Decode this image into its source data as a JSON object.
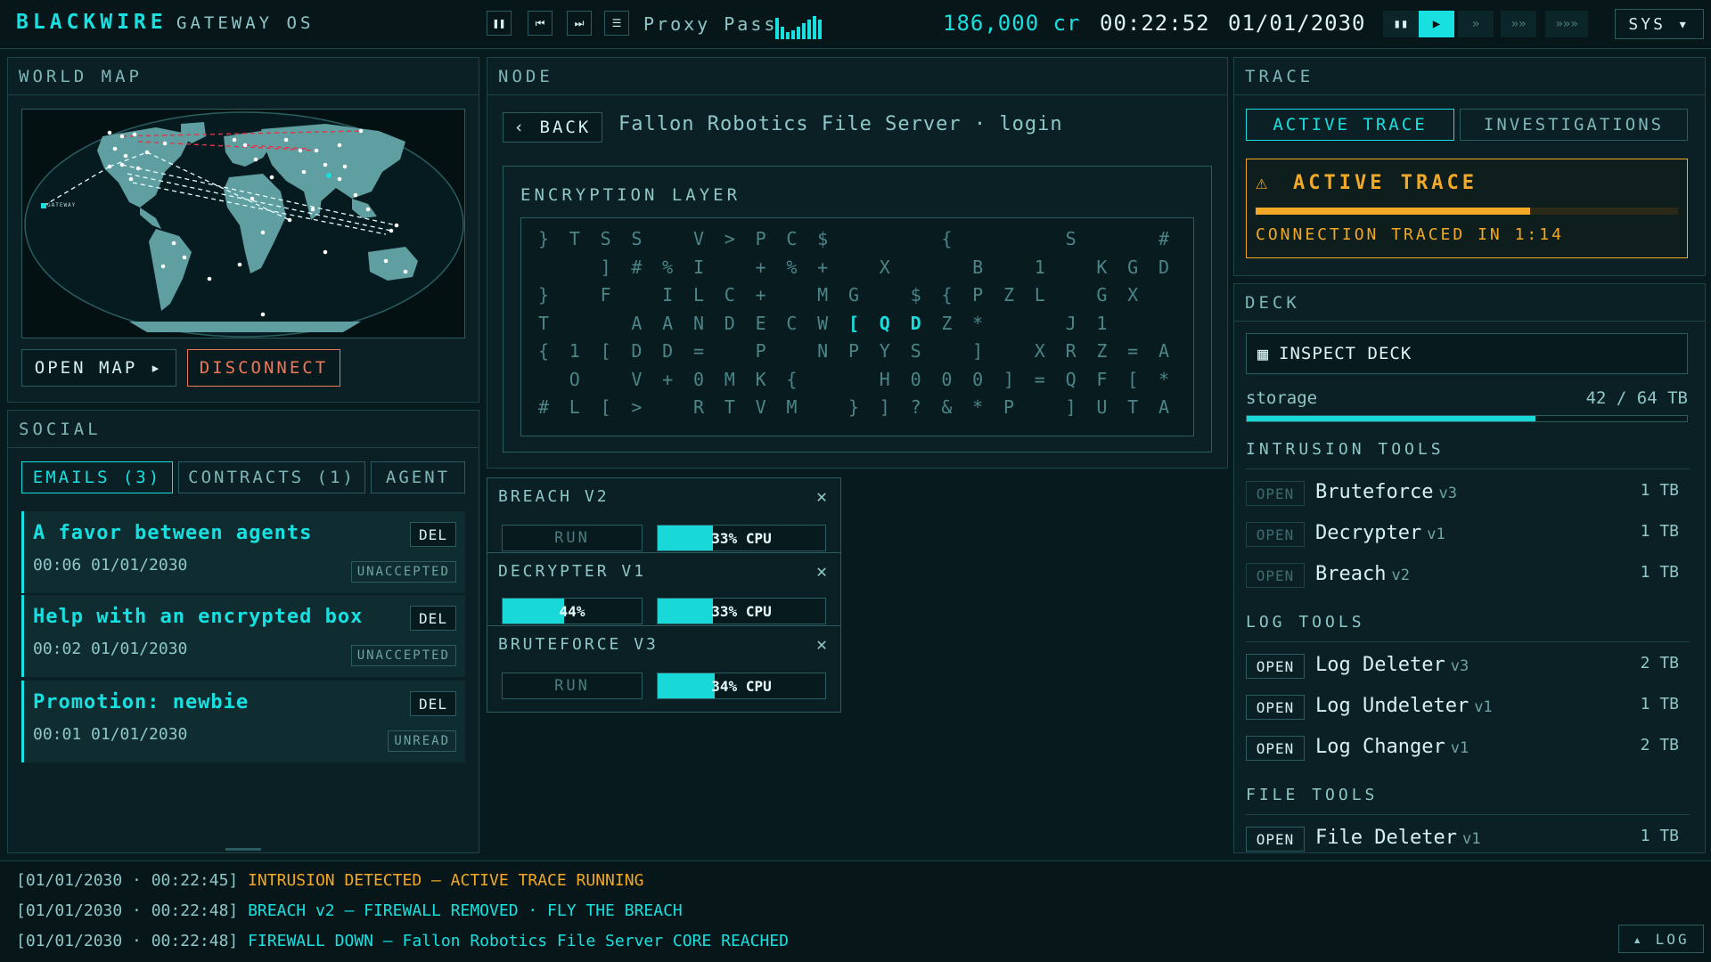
{
  "topbar": {
    "brand": "BLACKWIRE",
    "os": "GATEWAY OS",
    "track": "Proxy Pass",
    "credits": "186,000 cr",
    "clock": "00:22:52",
    "date": "01/01/2030",
    "sys": "SYS ▾"
  },
  "world_map": {
    "title": "WORLD MAP",
    "gateway_label": "GATEWAY",
    "open_map": "OPEN MAP ▸",
    "disconnect": "DISCONNECT"
  },
  "social": {
    "title": "SOCIAL",
    "tabs": [
      "EMAILS (3)",
      "CONTRACTS (1)",
      "AGENT"
    ],
    "emails": [
      {
        "title": "A favor between agents",
        "time": "00:06 01/01/2030",
        "status": "UNACCEPTED",
        "del": "DEL"
      },
      {
        "title": "Help with an encrypted box",
        "time": "00:02 01/01/2030",
        "status": "UNACCEPTED",
        "del": "DEL"
      },
      {
        "title": "Promotion: newbie",
        "time": "00:01 01/01/2030",
        "status": "UNREAD",
        "del": "DEL"
      }
    ]
  },
  "node": {
    "title": "NODE",
    "back": "‹ BACK",
    "server": "Fallon Robotics File Server · login",
    "enc_title": "ENCRYPTION LAYER",
    "enc_rows": [
      "}  T  S  S     V  >  P  C  $           {           S        #",
      "      ]  #  %  I     +  %  +     X        B     1     K  G  D",
      "}     F     I  L  C  +     M  G     $  {  P  Z  L     G  X   ",
      "T        A  A  N  D  E  C  W  [  Q  D  Z  *        J  1      ",
      "{  1  [  D  D  =     P     N  P  Y  S     ]     X  R  Z  =  A",
      "   O     V  +  0  M  K  {        H  0  0  0  ]  =  Q  F  [  *",
      "#  L  [  >     R  T  V  M     }  ]  ?  &  *  P     ]  U  T  A"
    ]
  },
  "tools": [
    {
      "title": "BREACH V2",
      "run": "RUN",
      "cpu": "33% CPU",
      "cpu_pct": 0.33
    },
    {
      "title": "DECRYPTER V1",
      "progress": "44%",
      "progress_pct": 0.44,
      "cpu": "33% CPU",
      "cpu_pct": 0.33
    },
    {
      "title": "BRUTEFORCE V3",
      "run": "RUN",
      "cpu": "34% CPU",
      "cpu_pct": 0.34
    }
  ],
  "trace": {
    "title": "TRACE",
    "tabs": [
      "ACTIVE TRACE",
      "INVESTIGATIONS"
    ],
    "alert_title": "ACTIVE TRACE",
    "progress_pct": 0.65,
    "alert_text": "CONNECTION TRACED IN 1:14"
  },
  "deck": {
    "title": "DECK",
    "inspect": "INSPECT DECK",
    "storage_label": "storage",
    "storage_value": "42 / 64 TB",
    "storage_pct": 0.656,
    "sections": [
      {
        "title": "INTRUSION TOOLS",
        "items": [
          {
            "open": "OPEN",
            "name": "Bruteforce",
            "ver": "v3",
            "size": "1 TB",
            "enabled": false
          },
          {
            "open": "OPEN",
            "name": "Decrypter",
            "ver": "v1",
            "size": "1 TB",
            "enabled": false
          },
          {
            "open": "OPEN",
            "name": "Breach",
            "ver": "v2",
            "size": "1 TB",
            "enabled": false
          }
        ]
      },
      {
        "title": "LOG TOOLS",
        "items": [
          {
            "open": "OPEN",
            "name": "Log Deleter",
            "ver": "v3",
            "size": "2 TB",
            "enabled": true
          },
          {
            "open": "OPEN",
            "name": "Log Undeleter",
            "ver": "v1",
            "size": "1 TB",
            "enabled": true
          },
          {
            "open": "OPEN",
            "name": "Log Changer",
            "ver": "v1",
            "size": "2 TB",
            "enabled": true
          }
        ]
      },
      {
        "title": "FILE TOOLS",
        "items": [
          {
            "open": "OPEN",
            "name": "File Deleter",
            "ver": "v1",
            "size": "1 TB",
            "enabled": true
          }
        ]
      }
    ]
  },
  "log": {
    "lines": [
      {
        "ts": "[01/01/2030 · 00:22:45]",
        "msg": "INTRUSION DETECTED — ACTIVE TRACE RUNNING"
      },
      {
        "ts": "[01/01/2030 · 00:22:48]",
        "msg": "BREACH v2 — FIREWALL REMOVED · FLY THE BREACH"
      },
      {
        "ts": "[01/01/2030 · 00:22:48]",
        "msg": "FIREWALL DOWN — Fallon Robotics File Server CORE REACHED"
      }
    ],
    "toggle": "▴ LOG"
  },
  "colors": {
    "accent": "#19e0e0",
    "warning": "#f3a927",
    "danger": "#f0785a"
  }
}
